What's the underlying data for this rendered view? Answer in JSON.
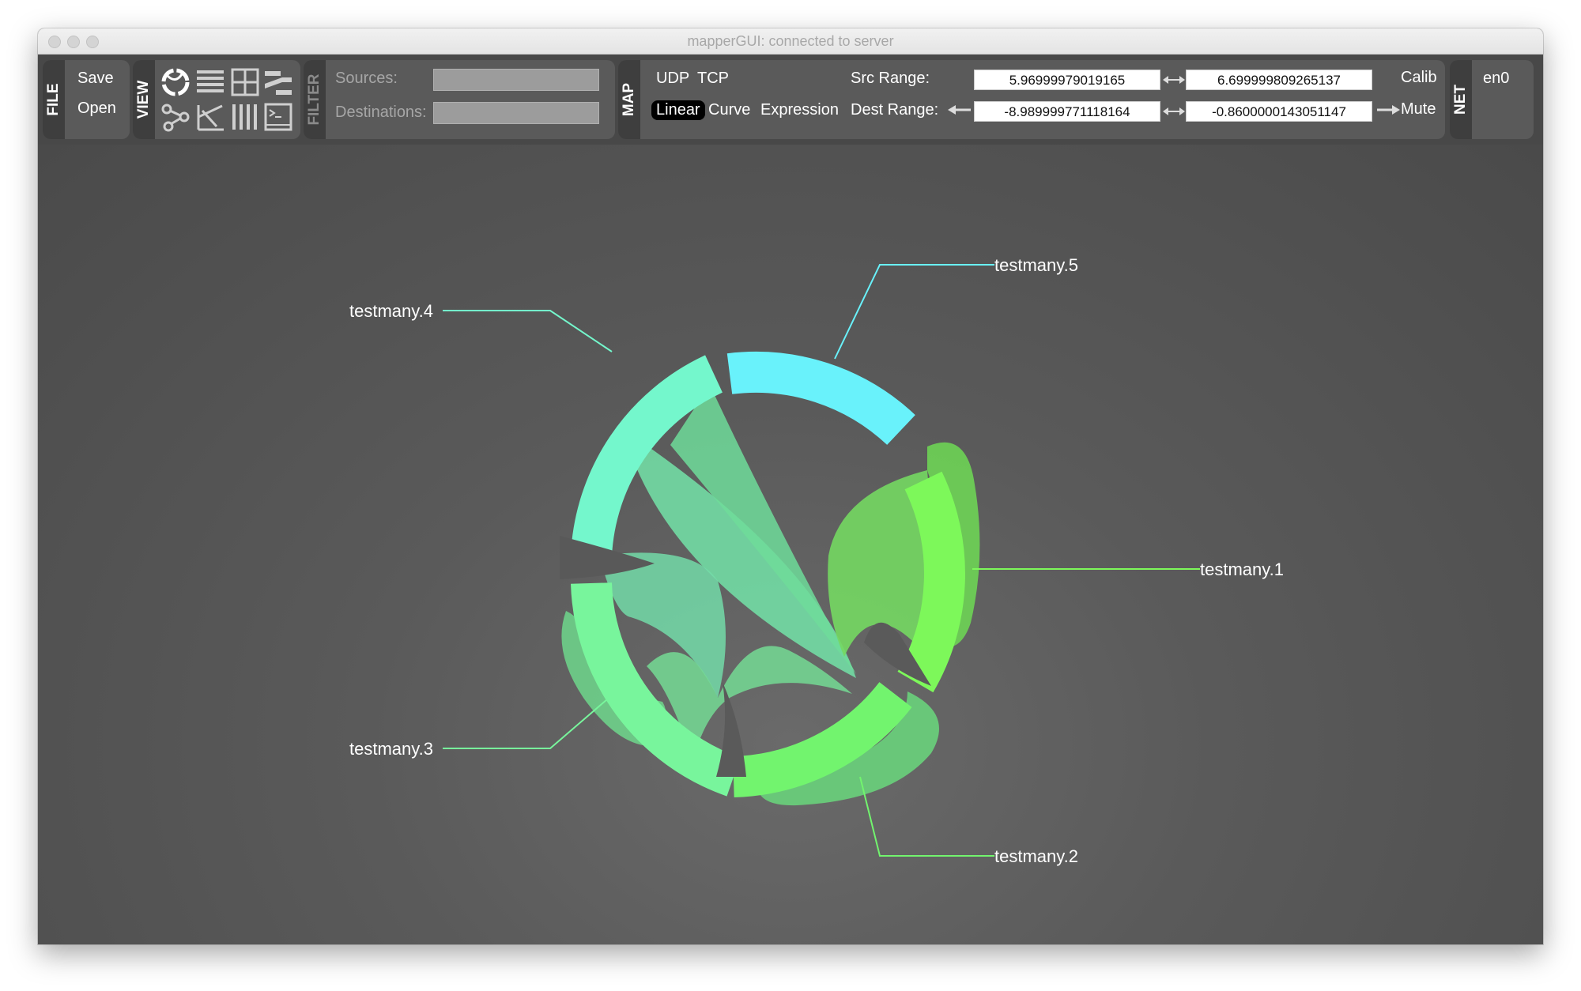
{
  "window": {
    "title": "mapperGUI: connected to server"
  },
  "toolbar": {
    "file": {
      "label": "FILE",
      "save": "Save",
      "open": "Open"
    },
    "view": {
      "label": "VIEW",
      "icons": [
        "chord-view-icon",
        "list-view-icon",
        "grid-view-icon",
        "parallel-view-icon",
        "graph-view-icon",
        "balloon-view-icon",
        "columns-view-icon",
        "console-view-icon"
      ]
    },
    "filter": {
      "label": "FILTER",
      "sources": "Sources:",
      "destinations": "Destinations:"
    },
    "map": {
      "label": "MAP",
      "udp": "UDP",
      "tcp": "TCP",
      "linear": "Linear",
      "curve": "Curve",
      "expression": "Expression",
      "src_range_label": "Src Range:",
      "dest_range_label": "Dest Range:",
      "src_min": "5.96999979019165",
      "src_max": "6.699999809265137",
      "dest_min": "-8.989999771118164",
      "dest_max": "-0.8600000143051147",
      "calib": "Calib",
      "mute": "Mute"
    },
    "net": {
      "label": "NET",
      "interface": "en0"
    }
  },
  "devices": [
    {
      "name": "testmany.1",
      "color": "#7df85a"
    },
    {
      "name": "testmany.2",
      "color": "#72f46e"
    },
    {
      "name": "testmany.3",
      "color": "#78f59c"
    },
    {
      "name": "testmany.4",
      "color": "#74f7cc"
    },
    {
      "name": "testmany.5",
      "color": "#69f2fb"
    }
  ]
}
